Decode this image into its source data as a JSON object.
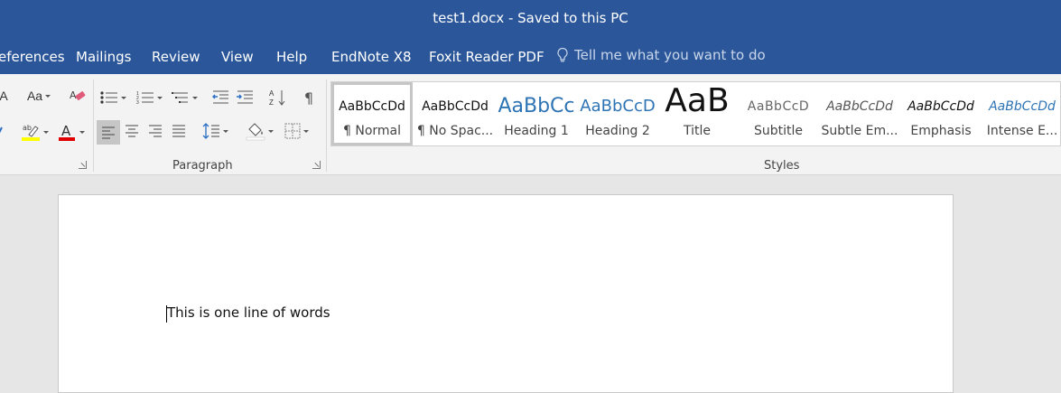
{
  "window": {
    "title": "test1.docx  -  Saved to this PC"
  },
  "tabs": [
    {
      "label": "eferences"
    },
    {
      "label": "Mailings"
    },
    {
      "label": "Review"
    },
    {
      "label": "View"
    },
    {
      "label": "Help"
    },
    {
      "label": "EndNote X8"
    },
    {
      "label": "Foxit Reader PDF"
    }
  ],
  "tellme": {
    "placeholder": "Tell me what you want to do",
    "icon": "lightbulb-icon"
  },
  "ribbon": {
    "font_group": {
      "change_case_label": "Aa",
      "grow_font_label": "A",
      "highlight_color": "#ffff00",
      "font_color": "#e00000"
    },
    "paragraph_group": {
      "label": "Paragraph",
      "active_alignment": "align-left"
    },
    "styles_group": {
      "label": "Styles",
      "items": [
        {
          "sample": "AaBbCcDd",
          "name": "¶ Normal",
          "selected": true
        },
        {
          "sample": "AaBbCcDd",
          "name": "¶ No Spac..."
        },
        {
          "sample": "AaBbCc",
          "name": "Heading 1"
        },
        {
          "sample": "AaBbCcD",
          "name": "Heading 2"
        },
        {
          "sample": "AaB",
          "name": "Title"
        },
        {
          "sample": "AaBbCcD",
          "name": "Subtitle"
        },
        {
          "sample": "AaBbCcDd",
          "name": "Subtle Em..."
        },
        {
          "sample": "AaBbCcDd",
          "name": "Emphasis"
        },
        {
          "sample": "AaBbCcDd",
          "name": "Intense E..."
        }
      ]
    }
  },
  "document": {
    "text": "This is one line of words"
  },
  "colors": {
    "accent": "#2b579a",
    "ribbon_bg": "#f3f3f3",
    "doc_bg": "#e6e6e6"
  }
}
